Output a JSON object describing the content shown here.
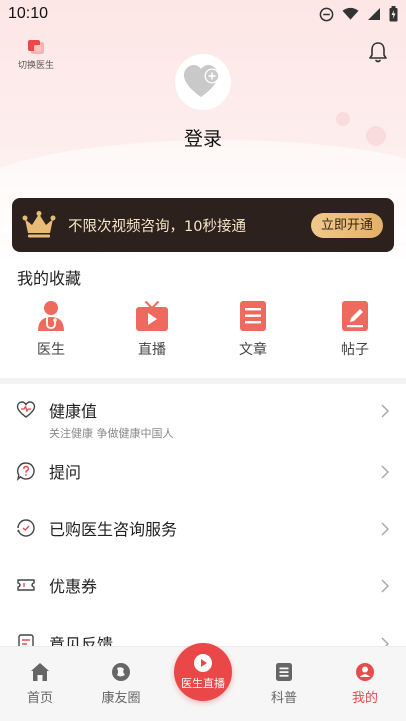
{
  "status_bar": {
    "time": "10:10"
  },
  "header": {
    "switch_label": "切换医生",
    "login_label": "登录"
  },
  "vip_banner": {
    "text": "不限次视频咨询，10秒接通",
    "button_label": "立即开通"
  },
  "favorites": {
    "title": "我的收藏",
    "items": [
      {
        "label": "医生",
        "icon": "doctor-icon"
      },
      {
        "label": "直播",
        "icon": "live-tv-icon"
      },
      {
        "label": "文章",
        "icon": "article-icon"
      },
      {
        "label": "帖子",
        "icon": "post-icon"
      }
    ]
  },
  "menu": [
    {
      "label": "健康值",
      "sub": "关注健康 争做健康中国人",
      "icon": "heart-icon"
    },
    {
      "label": "提问",
      "icon": "question-icon"
    },
    {
      "label": "已购医生咨询服务",
      "icon": "consult-icon"
    },
    {
      "label": "优惠券",
      "icon": "coupon-icon"
    },
    {
      "label": "意见反馈",
      "icon": "feedback-icon"
    }
  ],
  "tabbar": {
    "tabs": [
      {
        "label": "首页",
        "icon": "home-icon"
      },
      {
        "label": "康友圈",
        "icon": "community-icon"
      },
      {
        "label": "科普",
        "icon": "science-icon"
      },
      {
        "label": "我的",
        "icon": "profile-icon",
        "active": true
      }
    ],
    "live_label": "医生直播"
  },
  "colors": {
    "accent": "#e74c4a",
    "vip_bg": "#2c211d",
    "vip_gold": "#e8bb76"
  }
}
